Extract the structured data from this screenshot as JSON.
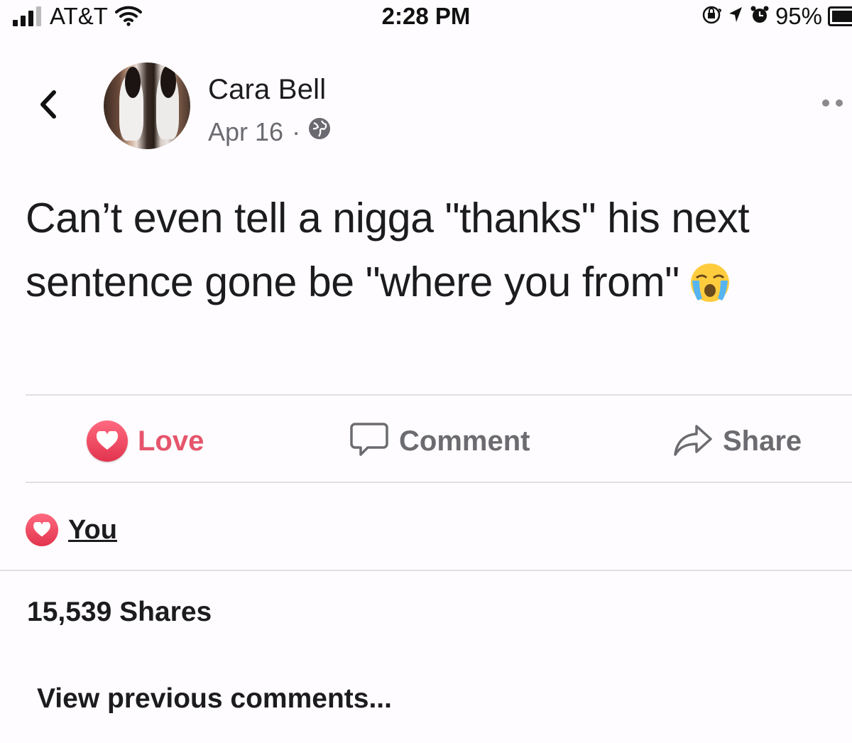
{
  "status_bar": {
    "carrier": "AT&T",
    "time": "2:28 PM",
    "battery_percent": "95%",
    "battery_level": 0.95,
    "icons": [
      "signal-icon",
      "wifi-icon",
      "orientation-lock-icon",
      "location-icon",
      "alarm-icon",
      "battery-icon"
    ]
  },
  "post": {
    "author": "Cara Bell",
    "date": "Apr 16",
    "separator": "·",
    "privacy_icon": "globe-icon",
    "text": "Can’t even tell a nigga \"thanks\" his next sentence gone be \"where you from\"",
    "emoji": "loudly-crying-face"
  },
  "actions": {
    "love_label": "Love",
    "comment_label": "Comment",
    "share_label": "Share"
  },
  "colors": {
    "love": "#e5556c",
    "action_gray": "#6b6b70",
    "text": "#1c1c1e",
    "meta": "#6a6a70"
  },
  "reactions": {
    "reactor": "You"
  },
  "shares_text": "15,539 Shares",
  "view_previous_label": "View previous comments..."
}
